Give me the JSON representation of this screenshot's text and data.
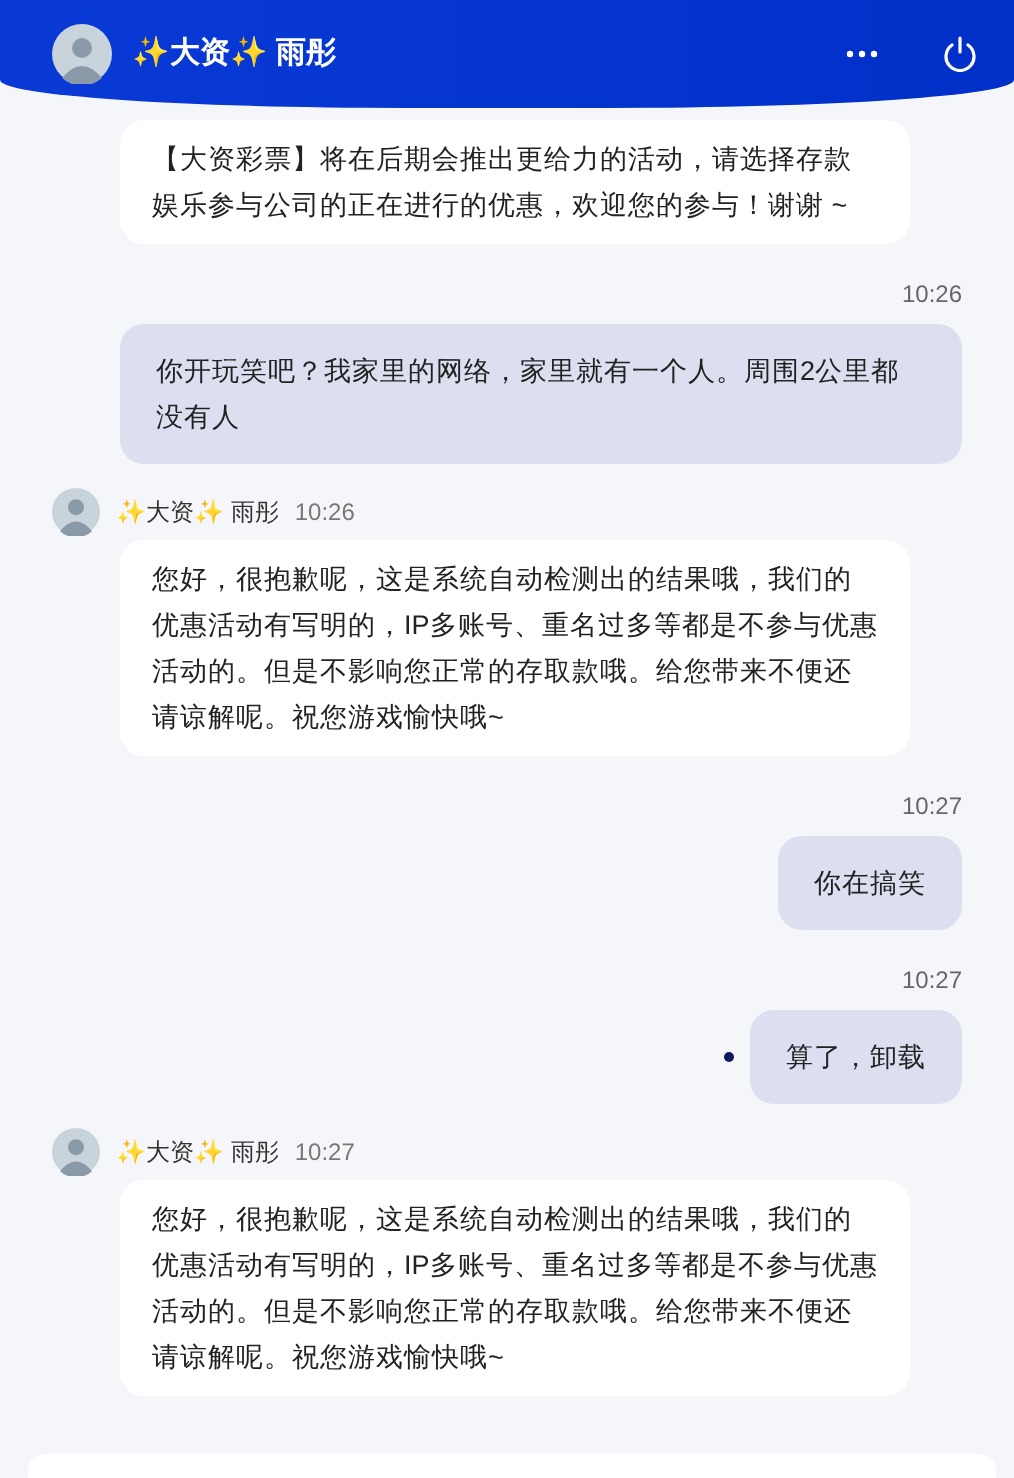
{
  "header": {
    "title": "✨大资✨ 雨彤"
  },
  "messages": [
    {
      "kind": "agent",
      "text": "【大资彩票】将在后期会推出更给力的活动，请选择存款娱乐参与公司的正在进行的优惠，欢迎您的参与！谢谢 ~"
    },
    {
      "kind": "time",
      "text": "10:26"
    },
    {
      "kind": "user",
      "text": "你开玩笑吧？我家里的网络，家里就有一个人。周围2公里都没有人",
      "unread": false
    },
    {
      "kind": "agent",
      "sender": "✨大资✨ 雨彤",
      "time": "10:26",
      "text": "您好，很抱歉呢，这是系统自动检测出的结果哦，我们的优惠活动有写明的，IP多账号、重名过多等都是不参与优惠活动的。但是不影响您正常的存取款哦。给您带来不便还请谅解呢。祝您游戏愉快哦~"
    },
    {
      "kind": "time",
      "text": "10:27"
    },
    {
      "kind": "user",
      "text": "你在搞笑",
      "unread": false
    },
    {
      "kind": "time",
      "text": "10:27"
    },
    {
      "kind": "user",
      "text": "算了，卸载",
      "unread": true
    },
    {
      "kind": "agent",
      "sender": "✨大资✨ 雨彤",
      "time": "10:27",
      "text": "您好，很抱歉呢，这是系统自动检测出的结果哦，我们的优惠活动有写明的，IP多账号、重名过多等都是不参与优惠活动的。但是不影响您正常的存取款哦。给您带来不便还请谅解呢。祝您游戏愉快哦~"
    }
  ]
}
